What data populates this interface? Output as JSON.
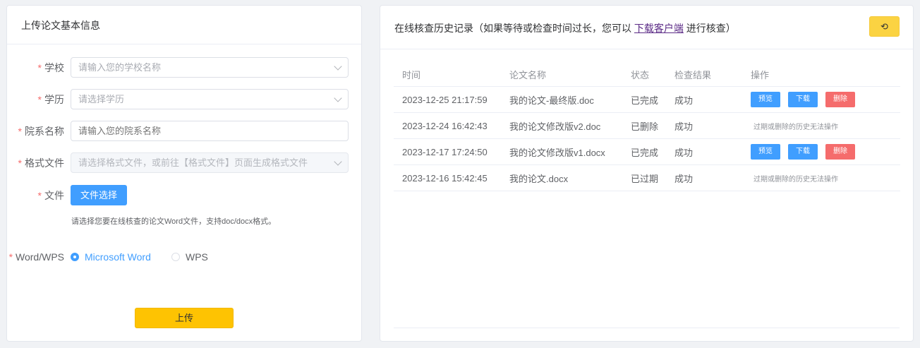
{
  "left_panel": {
    "title": "上传论文基本信息",
    "school": {
      "label": "学校",
      "placeholder": "请输入您的学校名称"
    },
    "degree": {
      "label": "学历",
      "placeholder": "请选择学历"
    },
    "department": {
      "label": "院系名称",
      "placeholder": "请输入您的院系名称"
    },
    "format_file": {
      "label": "格式文件",
      "placeholder": "请选择格式文件，或前往【格式文件】页面生成格式文件"
    },
    "file": {
      "label": "文件",
      "button": "文件选择",
      "hint": "请选择您要在线核查的论文Word文件，支持doc/docx格式。"
    },
    "word_wps": {
      "label": "Word/WPS",
      "options": [
        "Microsoft Word",
        "WPS"
      ],
      "selected": "Microsoft Word"
    },
    "upload_button": "上传"
  },
  "right_panel": {
    "title_prefix": "在线核查历史记录（如果等待或检查时间过长，您可以 ",
    "title_link": "下载客户端",
    "title_suffix": " 进行核查）",
    "refresh_icon": "refresh-icon",
    "refresh_glyph": "⟲",
    "columns": [
      "时间",
      "论文名称",
      "状态",
      "检查结果",
      "操作"
    ],
    "rows": [
      {
        "time": "2023-12-25 21:17:59",
        "name": "我的论文-最终版.doc",
        "status": "已完成",
        "result": "成功",
        "ops": [
          "预览",
          "下载",
          "删除"
        ],
        "note": ""
      },
      {
        "time": "2023-12-24 16:42:43",
        "name": "我的论文修改版v2.doc",
        "status": "已删除",
        "result": "成功",
        "ops": [],
        "note": "过期或删除的历史无法操作"
      },
      {
        "time": "2023-12-17 17:24:50",
        "name": "我的论文修改版v1.docx",
        "status": "已完成",
        "result": "成功",
        "ops": [
          "预览",
          "下载",
          "删除"
        ],
        "note": ""
      },
      {
        "time": "2023-12-16 15:42:45",
        "name": "我的论文.docx",
        "status": "已过期",
        "result": "成功",
        "ops": [],
        "note": "过期或删除的历史无法操作"
      }
    ]
  },
  "colors": {
    "primary": "#409eff",
    "danger": "#f56c6c",
    "upload": "#fec302",
    "refresh": "#fbd342"
  }
}
